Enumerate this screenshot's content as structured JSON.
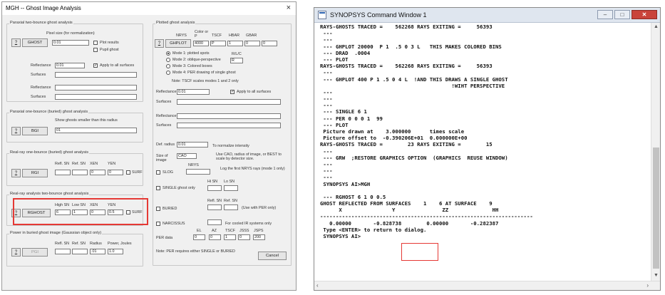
{
  "dialog": {
    "title": "MGH -- Ghost Image Analysis",
    "close": "×",
    "paraxial_two": {
      "title": "Paraxial two-bounce ghost analysis",
      "pixel_label": "Pixel size (for normalization)",
      "help": "?",
      "button": "GHOST",
      "pixel_value": "0.01",
      "plot_results": "Plot results",
      "pupil_ghost": "Pupil ghost",
      "reflectance_label": "Reflectance",
      "reflectance_value": "0.01",
      "apply_all": "Apply to all surfaces",
      "surfaces_label": "Surfaces",
      "reflectance2_label": "Reflectance",
      "surfaces2_label": "Surfaces"
    },
    "paraxial_one": {
      "title": "Paraxial one-bounce (buried) ghost analysis",
      "note": "Show ghosts smaller than this radius",
      "help": "?",
      "button": "BGI",
      "value": "01"
    },
    "realray_one": {
      "title": "Real-ray one-bounce (buried) ghost analysis",
      "col1": "Refl. SN",
      "col2": "Ref. SN",
      "col3": "XEN",
      "col4": "YEN",
      "help": "?",
      "button": "RGI",
      "v3": "0",
      "v4": "0",
      "surf": "SURF"
    },
    "realray_two": {
      "title": "Real-ray analysis two-bounce ghost analysis",
      "col1": "High SN",
      "col2": "Low SN",
      "col3": "XEN",
      "col4": "YEN",
      "help": "?",
      "button": "RGHOST",
      "v1": "6",
      "v2": "1",
      "v3": "0",
      "v4": "0.5",
      "surf": "SURF"
    },
    "power": {
      "title": "Power in buried ghost image (Gaussian object only)",
      "col1": "Refl. SN",
      "col2": "Ref. SN",
      "col3": "Radius",
      "col4": "Power, Joules",
      "help": "?",
      "button": "PGI",
      "v3": ".01",
      "v4": "1.0"
    },
    "plotted": {
      "title": "Plotted ghost analysis",
      "h_nrys": "NRYS",
      "h_color": "Color or P",
      "h_tscf": "TSCF",
      "h_hbar": "HBAR",
      "h_gbar": "GBAR",
      "help": "?",
      "button": "GHPLOT",
      "v_nrys": "4000",
      "v_color": "P",
      "v_tscf": "1",
      "v_hbar": "0",
      "v_gbar": "0",
      "mode1": "Mode 1: plotted spots",
      "mode2": "Mode 2: oblique-perspective",
      "mode3": "Mode 3: Colored boxes",
      "mode4": "Mode 4: PER drawing of single ghost",
      "rlc_label": "R/L/C",
      "rlc_value": "R",
      "note": "Note: TSCF scales modes 1 and 2 only",
      "reflectance_label": "Reflectance",
      "reflectance_value": "0.01",
      "apply_all": "Apply to all surfaces",
      "surfaces_label": "Surfaces",
      "reflectance2_label": "Reflectance",
      "surfaces2_label": "Surfaces",
      "defradius_label": "Def. radius",
      "defradius_value": "0.01",
      "normalize_note": "To normalize intensity",
      "size_label": "Size of image",
      "size_value": "CAO",
      "size_note": "Use CAO, radius of image, or BEST to scale by detector size.",
      "slog": "SLOG",
      "nrys_label": "NRYS",
      "log_note": "Log the first NRYS rays (mode 1 only)",
      "single_only": "SINGLE ghost only",
      "hi_sn": "Hi SN",
      "lo_sn": "Lo SN",
      "refl_sn": "Refl. SN",
      "ref_sn": "Ref. SN",
      "buried": "BURIED",
      "per_note": "(Use with PER only)",
      "narcissus": "NARCISSUS",
      "cooled_note": "For cooled IR systems only",
      "h_el": "EL",
      "h_az": "AZ",
      "h_tscf2": "TSCF",
      "h_jsss": "JSSS",
      "h_jsps": "JSPS",
      "per_label": "PER data",
      "v_el": "0",
      "v_az": "0",
      "v_tscf2": "1",
      "v_jsss": "0",
      "v_jsps": "200",
      "bottom_note": "Note: PER requires either SINGLE or BURIED",
      "cancel": "Cancel"
    }
  },
  "console": {
    "title": "SYNOPSYS Command Window 1",
    "lines": [
      "RAYS-GHOSTS TRACED =    562268 RAYS EXITING =     56393",
      " ---",
      " ---",
      " --- GHPLOT 20000  P 1  .5 0 3 L   THIS MAKES COLORED BINS",
      " --- DRAD  .0004",
      " --- PLOT",
      "RAYS-GHOSTS TRACED =    562268 RAYS EXITING =     56393",
      " ---",
      " --- GHPLOT 400 P 1 .5 0 4 L  !AND THIS DRAWS A SINGLE GHOST",
      "                                          !WIHT PERSPECTIVE",
      " ---",
      " ---",
      " ---",
      " --- SINGLE 6 1",
      " --- PER 0 0 0 1  99",
      " --- PLOT",
      " Picture drawn at    3.000000      times scale",
      " Picture offset to  -0.390206E+01  0.000000E+00",
      "RAYS-GHOSTS TRACED =        23 RAYS EXITING =        15",
      " ---",
      " --- GRW  ;RESTORE GRAPHICS OPTION  (GRAPHICS  REUSE WINDOW)",
      " ---",
      " ---",
      " ---",
      " SYNOPSYS AI>MGH",
      "",
      " --- RGHOST 6 1 0 0.5",
      "GHOST REFLECTED FROM SURFACES    1    6 AT SURFACE    9",
      "      X                Y               ZZ              HH",
      "--------------------------------------------------------------------",
      "   0.00000       -0.828738        0.00000       -0.282387",
      " Type <ENTER> to return to dialog.",
      " SYNOPSYS AI>"
    ]
  }
}
